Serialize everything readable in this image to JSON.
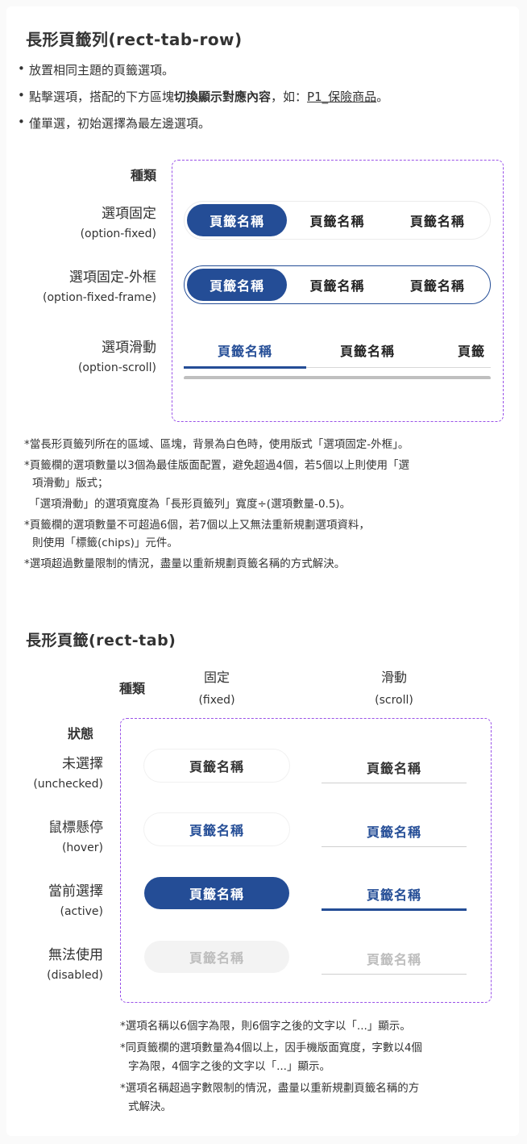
{
  "section1": {
    "title": "長形頁籤列(rect-tab-row)",
    "bullets": [
      "放置相同主題的頁籤選項。",
      "僅單選，初始選擇為最左邊選項。"
    ],
    "bullet2": {
      "pre": "點擊選項，搭配的下方區塊",
      "bold": "切換顯示對應內容",
      "mid": "，如：",
      "link": "P1_保險商品",
      "post": "。"
    },
    "kind_header": "種類",
    "rows": [
      {
        "label": "選項固定",
        "sub": "(option-fixed)"
      },
      {
        "label": "選項固定-外框",
        "sub": "(option-fixed-frame)"
      },
      {
        "label": "選項滑動",
        "sub": "(option-scroll)"
      }
    ],
    "tab_label": "頁籤名稱",
    "scroll_partial": "頁籤",
    "notes": [
      "*當長形頁籤列所在的區域、區塊，背景為白色時，使用版式「選項固定-外框」。",
      "*頁籤欄的選項數量以3個為最佳版面配置，避免超過4個，若5個以上則使用「選",
      "項滑動」版式；",
      "「選項滑動」的選項寬度為「長形頁籤列」寬度÷(選項數量-0.5)。",
      "*頁籤欄的選項數量不可超過6個，若7個以上又無法重新規劃選項資料，",
      "則使用「標籤(chips)」元件。",
      "*選項超過數量限制的情況，盡量以重新規劃頁籤名稱的方式解決。"
    ]
  },
  "section2": {
    "title": "長形頁籤(rect-tab)",
    "kind_header": "種類",
    "state_header": "狀態",
    "col_fixed": {
      "label": "固定",
      "sub": "(fixed)"
    },
    "col_scroll": {
      "label": "滑動",
      "sub": "(scroll)"
    },
    "states": [
      {
        "label": "未選擇",
        "sub": "(unchecked)"
      },
      {
        "label": "鼠標懸停",
        "sub": "(hover)"
      },
      {
        "label": "當前選擇",
        "sub": "(active)"
      },
      {
        "label": "無法使用",
        "sub": "(disabled)"
      }
    ],
    "tab_label": "頁籤名稱",
    "notes": [
      "*選項名稱以6個字為限，則6個字之後的文字以「...」顯示。",
      "*同頁籤欄的選項數量為4個以上，因手機版面寬度，字數以4個",
      "字為限，4個字之後的文字以「...」顯示。",
      "*選項名稱超過字數限制的情況，盡量以重新規劃頁籤名稱的方",
      "式解決。"
    ]
  },
  "colors": {
    "accent": "#244d96",
    "dashed": "#9a52e8",
    "disabled_text": "#bdbdbd"
  }
}
